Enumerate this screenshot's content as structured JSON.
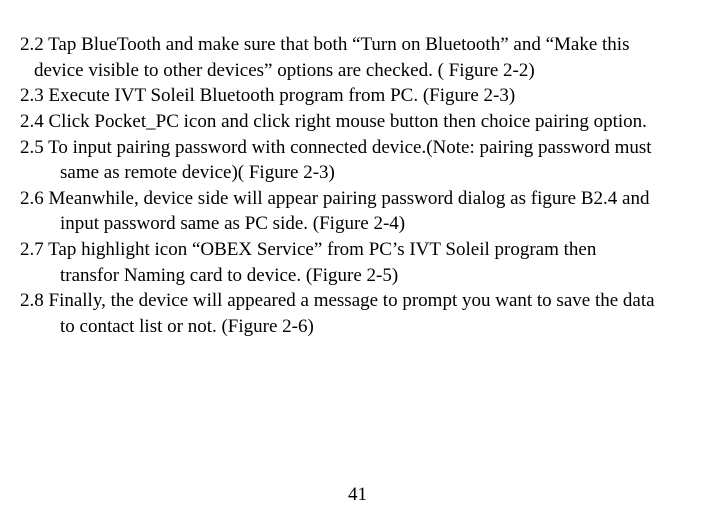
{
  "lines": {
    "l1": "2.2 Tap BlueTooth and make sure that both “Turn on Bluetooth” and “Make this",
    "l2": "device visible to other devices” options are checked. ( Figure 2-2)",
    "l3": "2.3 Execute IVT Soleil Bluetooth program from PC. (Figure 2-3)",
    "l4": "2.4 Click Pocket_PC icon and click right mouse button then choice pairing option.",
    "l5": "2.5 To input pairing password with connected device.(Note: pairing password must",
    "l6": "same as remote device)( Figure 2-3)",
    "l7": "2.6 Meanwhile, device side will appear pairing password dialog as figure B2.4 and",
    "l8": "input password same as PC side. (Figure 2-4)",
    "l9": "2.7 Tap highlight icon “OBEX Service” from PC’s IVT Soleil program then",
    "l10": "transfor Naming card to device. (Figure 2-5)",
    "l11": "2.8 Finally, the device will appeared a message to prompt you want to save the data",
    "l12": "to contact list or not. (Figure 2-6)"
  },
  "page_number": "41"
}
